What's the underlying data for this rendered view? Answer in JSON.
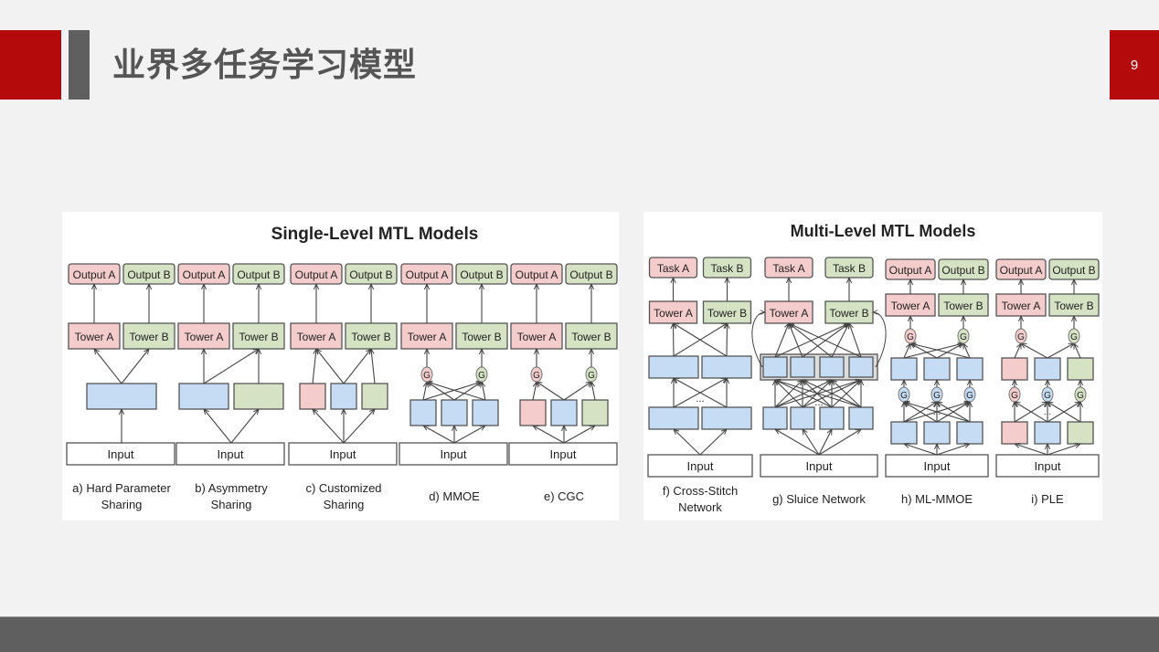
{
  "slide": {
    "title": "业界多任务学习模型",
    "page_number": "9"
  },
  "colors": {
    "brand_red": "#b50a0c",
    "accent_gray": "#5f5f5f",
    "task_a_fill": "#f4cccc",
    "task_b_fill": "#d5e3c4",
    "expert_fill": "#c6dcf5"
  },
  "single_level": {
    "heading": "Single-Level MTL Models",
    "models": [
      {
        "id": "a",
        "caption_line1": "a) Hard Parameter",
        "caption_line2": "Sharing",
        "output_a": "Output A",
        "output_b": "Output B",
        "tower_a": "Tower A",
        "tower_b": "Tower B",
        "input": "Input"
      },
      {
        "id": "b",
        "caption_line1": "b) Asymmetry",
        "caption_line2": "Sharing",
        "output_a": "Output A",
        "output_b": "Output B",
        "tower_a": "Tower A",
        "tower_b": "Tower B",
        "input": "Input"
      },
      {
        "id": "c",
        "caption_line1": "c) Customized",
        "caption_line2": "Sharing",
        "output_a": "Output A",
        "output_b": "Output B",
        "tower_a": "Tower A",
        "tower_b": "Tower B",
        "input": "Input"
      },
      {
        "id": "d",
        "caption_line1": "d) MMOE",
        "caption_line2": "",
        "output_a": "Output A",
        "output_b": "Output B",
        "tower_a": "Tower A",
        "tower_b": "Tower B",
        "input": "Input",
        "gate": "G"
      },
      {
        "id": "e",
        "caption_line1": "e) CGC",
        "caption_line2": "",
        "output_a": "Output A",
        "output_b": "Output B",
        "tower_a": "Tower A",
        "tower_b": "Tower B",
        "input": "Input",
        "gate": "G"
      }
    ]
  },
  "multi_level": {
    "heading": "Multi-Level MTL Models",
    "models": [
      {
        "id": "f",
        "caption_line1": "f) Cross-Stitch",
        "caption_line2": "Network",
        "output_a": "Task A",
        "output_b": "Task B",
        "tower_a": "Tower A",
        "tower_b": "Tower B",
        "input": "Input",
        "ellipsis": "..."
      },
      {
        "id": "g",
        "caption_line1": "g) Sluice Network",
        "caption_line2": "",
        "output_a": "Task A",
        "output_b": "Task B",
        "tower_a": "Tower A",
        "tower_b": "Tower B",
        "input": "Input",
        "ellipsis": "..."
      },
      {
        "id": "h",
        "caption_line1": "h) ML-MMOE",
        "caption_line2": "",
        "output_a": "Output A",
        "output_b": "Output B",
        "tower_a": "Tower A",
        "tower_b": "Tower B",
        "input": "Input",
        "gate": "G",
        "ellipsis": "..."
      },
      {
        "id": "i",
        "caption_line1": "i) PLE",
        "caption_line2": "",
        "output_a": "Output A",
        "output_b": "Output B",
        "tower_a": "Tower A",
        "tower_b": "Tower B",
        "input": "Input",
        "gate": "G",
        "ellipsis": "..."
      }
    ]
  }
}
